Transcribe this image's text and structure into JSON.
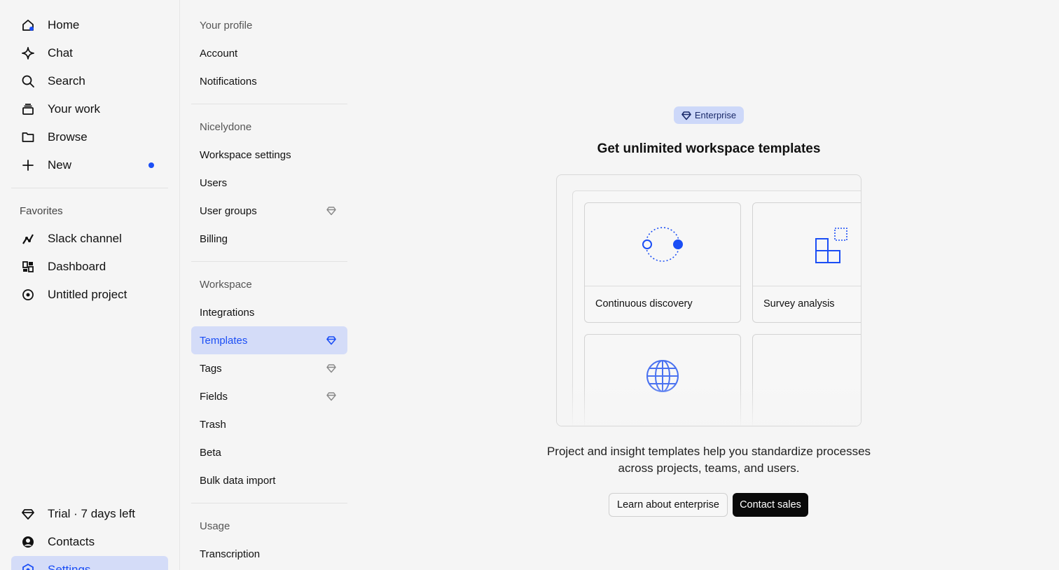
{
  "nav": {
    "items": [
      {
        "label": "Home",
        "icon": "home-icon"
      },
      {
        "label": "Chat",
        "icon": "sparkle-icon"
      },
      {
        "label": "Search",
        "icon": "search-icon"
      },
      {
        "label": "Your work",
        "icon": "stack-icon"
      },
      {
        "label": "Browse",
        "icon": "folder-icon"
      },
      {
        "label": "New",
        "icon": "plus-icon"
      }
    ],
    "favorites_heading": "Favorites",
    "favorites": [
      {
        "label": "Slack channel",
        "icon": "chart-line-icon"
      },
      {
        "label": "Dashboard",
        "icon": "dashboard-icon"
      },
      {
        "label": "Untitled project",
        "icon": "target-icon"
      }
    ],
    "bottom": [
      {
        "label": "Trial · 7 days left",
        "icon": "gem-icon"
      },
      {
        "label": "Contacts",
        "icon": "user-circle-icon"
      },
      {
        "label": "Settings",
        "icon": "settings-icon"
      }
    ]
  },
  "settings_nav": {
    "profile_heading": "Your profile",
    "profile_items": [
      "Account",
      "Notifications"
    ],
    "org_heading": "Nicelydone",
    "org_items": [
      "Workspace settings",
      "Users",
      "User groups",
      "Billing"
    ],
    "workspace_heading": "Workspace",
    "workspace_items": [
      "Integrations",
      "Templates",
      "Tags",
      "Fields",
      "Trash",
      "Beta",
      "Bulk data import"
    ],
    "usage_heading": "Usage",
    "usage_items": [
      "Transcription"
    ]
  },
  "main": {
    "badge": "Enterprise",
    "title": "Get unlimited workspace templates",
    "cards": [
      "Continuous discovery",
      "Survey analysis"
    ],
    "description": "Project and insight templates help you standardize processes across projects, teams, and users.",
    "learn_button": "Learn about enterprise",
    "contact_button": "Contact sales"
  },
  "colors": {
    "accent": "#1b4ef5",
    "active_bg": "#d4dcf8",
    "badge_bg": "#cdd8f9",
    "primary_button": "#0a0a0a"
  }
}
